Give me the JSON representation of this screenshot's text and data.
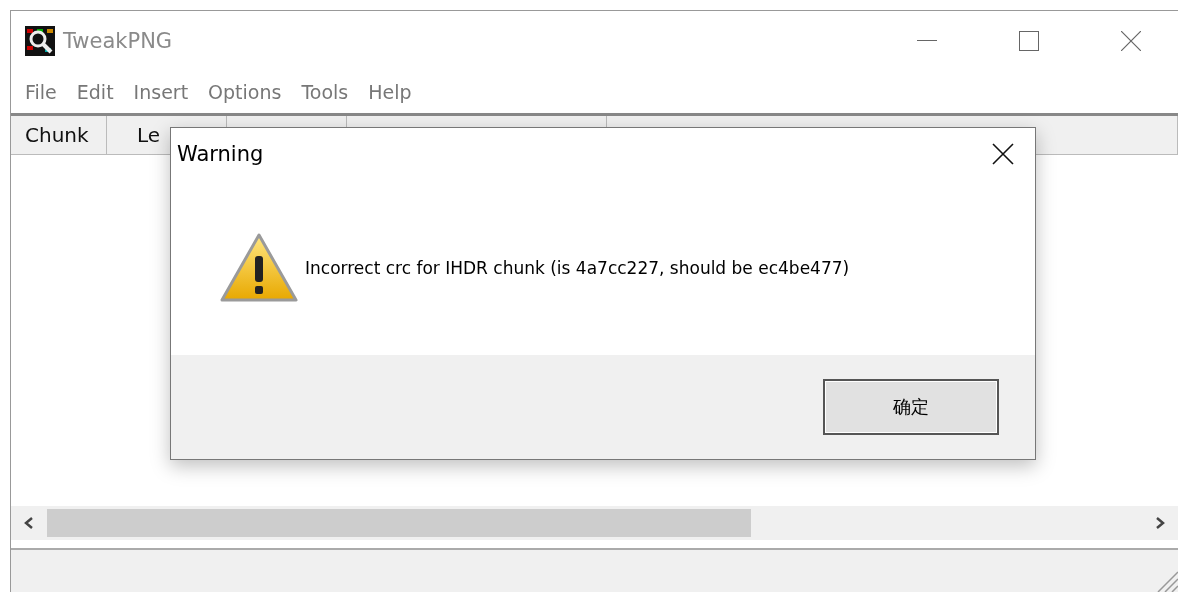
{
  "window": {
    "title": "TweakPNG"
  },
  "menu": [
    "File",
    "Edit",
    "Insert",
    "Options",
    "Tools",
    "Help"
  ],
  "table": {
    "columns": [
      "Chunk",
      "Le",
      "",
      "",
      ""
    ]
  },
  "dialog": {
    "title": "Warning",
    "message": "Incorrect crc for IHDR chunk (is 4a7cc227, should be ec4be477)",
    "buttons": [
      "确定"
    ]
  }
}
